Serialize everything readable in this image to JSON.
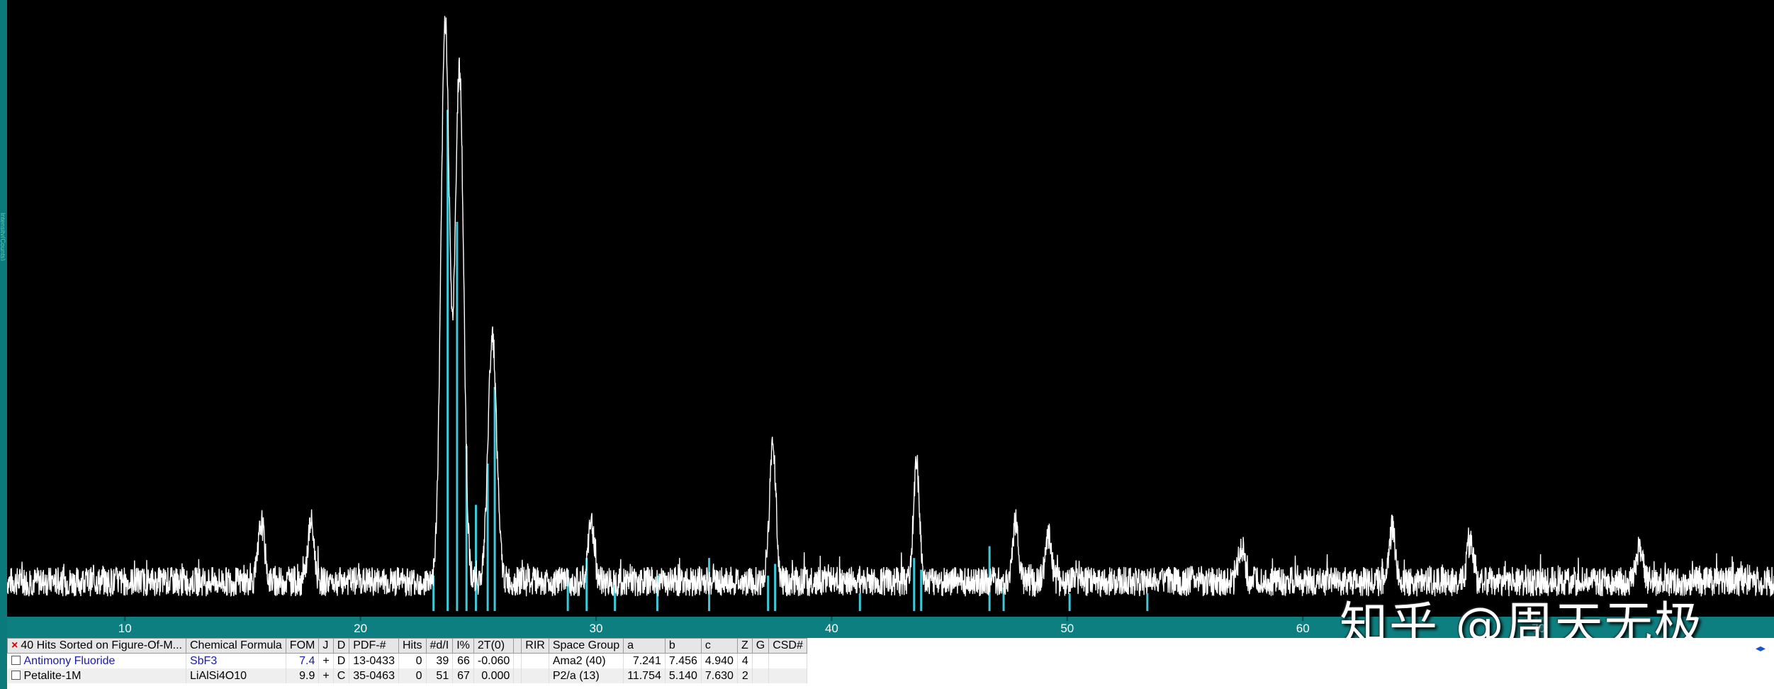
{
  "chart_data": {
    "type": "line",
    "title": "",
    "xlabel": "",
    "ylabel": "",
    "xlim": [
      5,
      80
    ],
    "ylim": [
      0,
      100
    ],
    "x_ticks": [
      10,
      20,
      30,
      40,
      50,
      60,
      70
    ],
    "x_tick_labels": [
      "10",
      "20",
      "30",
      "40",
      "50",
      "60",
      "70"
    ],
    "grid": false,
    "series": [
      {
        "kind": "diffraction-pattern",
        "color": "#ffffff",
        "background": 5,
        "noise": 2.5,
        "peaks": [
          {
            "x": 15.8,
            "y": 10
          },
          {
            "x": 17.9,
            "y": 10
          },
          {
            "x": 23.6,
            "y": 95
          },
          {
            "x": 24.2,
            "y": 87
          },
          {
            "x": 25.6,
            "y": 42
          },
          {
            "x": 29.8,
            "y": 10
          },
          {
            "x": 37.5,
            "y": 24
          },
          {
            "x": 43.6,
            "y": 20
          },
          {
            "x": 47.8,
            "y": 10
          },
          {
            "x": 49.2,
            "y": 8
          },
          {
            "x": 57.4,
            "y": 6
          },
          {
            "x": 63.8,
            "y": 9
          },
          {
            "x": 67.1,
            "y": 7
          },
          {
            "x": 74.3,
            "y": 6
          }
        ]
      },
      {
        "kind": "reference-stick-lines",
        "color": "#3ec8d8",
        "sticks": [
          {
            "x": 23.1,
            "y": 6
          },
          {
            "x": 23.7,
            "y": 85
          },
          {
            "x": 24.1,
            "y": 66
          },
          {
            "x": 24.5,
            "y": 28
          },
          {
            "x": 24.9,
            "y": 18
          },
          {
            "x": 25.4,
            "y": 25
          },
          {
            "x": 25.7,
            "y": 38
          },
          {
            "x": 28.8,
            "y": 7
          },
          {
            "x": 29.6,
            "y": 9
          },
          {
            "x": 30.8,
            "y": 5
          },
          {
            "x": 32.6,
            "y": 6
          },
          {
            "x": 34.8,
            "y": 9
          },
          {
            "x": 37.3,
            "y": 6
          },
          {
            "x": 37.6,
            "y": 8
          },
          {
            "x": 41.2,
            "y": 3
          },
          {
            "x": 43.5,
            "y": 9
          },
          {
            "x": 43.8,
            "y": 7
          },
          {
            "x": 46.7,
            "y": 11
          },
          {
            "x": 47.3,
            "y": 4
          },
          {
            "x": 50.1,
            "y": 3
          },
          {
            "x": 53.4,
            "y": 3
          }
        ]
      }
    ]
  },
  "watermark": "知乎 @周天无极",
  "side_label": "Intensity(Counts)",
  "table": {
    "title": "40 Hits Sorted on Figure-Of-M...",
    "headers": [
      "Chemical Formula",
      "FOM",
      "J",
      "D",
      "PDF-#",
      "Hits",
      "#d/I",
      "I%",
      "2T(0)",
      "",
      "RIR",
      "Space Group",
      "a",
      "b",
      "c",
      "Z",
      "G",
      "CSD#"
    ],
    "rows": [
      {
        "name": "Antimony Fluoride",
        "formula": "SbF3",
        "fom": "7.4",
        "j": "+",
        "d": "D",
        "pdf": "13-0433",
        "hits": "0",
        "dI": "39",
        "ipct": "66",
        "t2": "-0.060",
        "blank": "",
        "rir": "",
        "sg": "Ama2 (40)",
        "a": "7.241",
        "b": "7.456",
        "c": "4.940",
        "z": "4",
        "g": "",
        "csd": ""
      },
      {
        "name": "Petalite-1M",
        "formula": "LiAlSi4O10",
        "fom": "9.9",
        "j": "+",
        "d": "C",
        "pdf": "35-0463",
        "hits": "0",
        "dI": "51",
        "ipct": "67",
        "t2": "0.000",
        "blank": "",
        "rir": "",
        "sg": "P2/a (13)",
        "a": "11.754",
        "b": "5.140",
        "c": "7.630",
        "z": "2",
        "g": "",
        "csd": ""
      }
    ]
  },
  "colors": {
    "background": "#000000",
    "pattern": "#ffffff",
    "sticks": "#3ec8d8",
    "axis_strip": "#0e7f80",
    "selected_row_text": "#1a1aa8"
  }
}
